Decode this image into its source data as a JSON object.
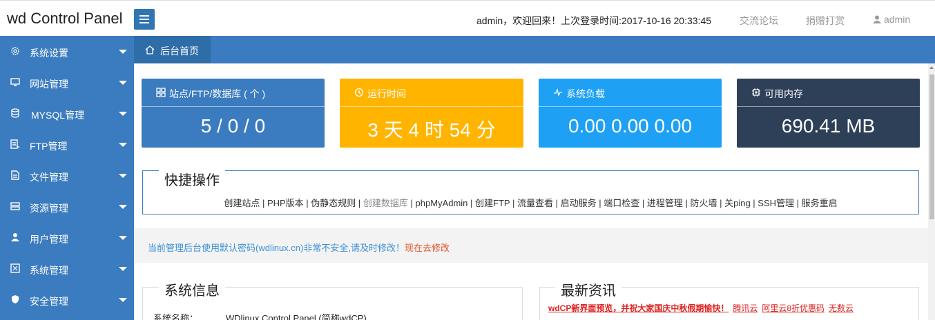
{
  "header": {
    "brand": "wd Control Panel",
    "welcome": "admin，欢迎回来！上次登录时间:2017-10-16 20:33:45",
    "links": [
      "交流论坛",
      "捐赠打赏"
    ],
    "user": "admin"
  },
  "sidebar": {
    "items": [
      {
        "label": "系统设置",
        "icon": "gear-icon"
      },
      {
        "label": "网站管理",
        "icon": "monitor-icon"
      },
      {
        "label": "MYSQL管理",
        "icon": "database-icon"
      },
      {
        "label": "FTP管理",
        "icon": "ftp-icon"
      },
      {
        "label": "文件管理",
        "icon": "file-icon"
      },
      {
        "label": "资源管理",
        "icon": "server-icon"
      },
      {
        "label": "用户管理",
        "icon": "user-icon"
      },
      {
        "label": "系统管理",
        "icon": "system-icon"
      },
      {
        "label": "安全管理",
        "icon": "shield-icon"
      }
    ]
  },
  "breadcrumb": {
    "label": "后台首页",
    "icon": "home-icon"
  },
  "stats": [
    {
      "title": "站点/FTP/数据库 ( 个 )",
      "value": "5 / 0 / 0",
      "color": "#3b7bbf",
      "icon": "grid-icon"
    },
    {
      "title": "运行时间",
      "value": "3 天 4 时 54 分",
      "color": "#ffb400",
      "icon": "clock-icon"
    },
    {
      "title": "系统负载",
      "value": "0.00 0.00 0.00",
      "color": "#1ea0f5",
      "icon": "pulse-icon"
    },
    {
      "title": "可用内存",
      "value": "690.41 MB",
      "color": "#2e3f58",
      "icon": "chip-icon"
    }
  ],
  "quick": {
    "title": "快捷操作",
    "links": [
      "创建站点",
      "PHP版本",
      "伪静态规则",
      "创建数据库",
      "phpMyAdmin",
      "创建FTP",
      "流量查看",
      "启动服务",
      "端口检查",
      "进程管理",
      "防火墙",
      "关ping",
      "SSH管理",
      "服务重启"
    ]
  },
  "warning": {
    "text": "当前管理后台使用默认密码(wdlinux.cn)非常不安全,请及时修改！",
    "action": "现在去修改"
  },
  "sysinfo": {
    "title": "系统信息",
    "row_label": "系统名称：",
    "row_value": "WDlinux Control Panel (简称wdCP)"
  },
  "news": {
    "title": "最新资讯",
    "items": [
      "wdCP新界面预览，并祝大家国庆中秋假期愉快！",
      "腾讯云",
      "阿里云8折优惠码",
      "无数云"
    ]
  }
}
